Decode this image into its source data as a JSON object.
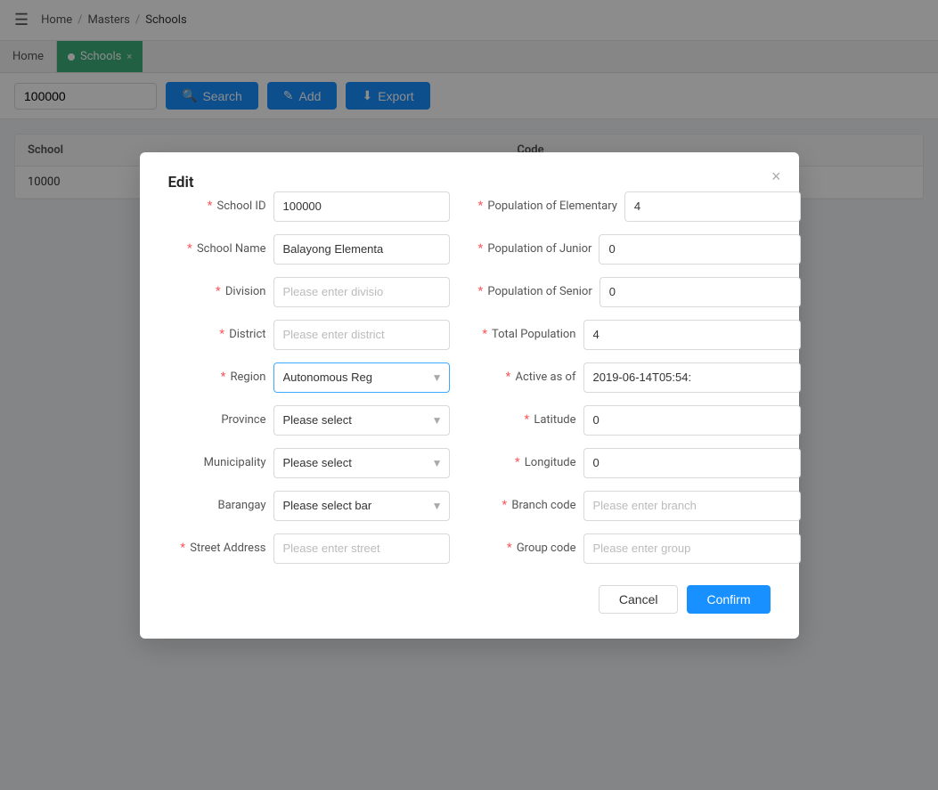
{
  "topbar": {
    "menu_icon": "☰",
    "breadcrumb": {
      "home": "Home",
      "sep1": "/",
      "masters": "Masters",
      "sep2": "/",
      "current": "Schools"
    }
  },
  "tabbar": {
    "home_label": "Home",
    "tab_label": "Schools",
    "tab_close": "×"
  },
  "toolbar": {
    "search_value": "100000",
    "search_btn": "Search",
    "add_btn": "Add",
    "export_btn": "Export"
  },
  "table": {
    "columns": [
      "School",
      "Code"
    ],
    "rows": [
      {
        "school": "10000",
        "code": ""
      }
    ]
  },
  "modal": {
    "title": "Edit",
    "close": "×",
    "fields": {
      "school_id_label": "School ID",
      "school_id_value": "100000",
      "pop_elem_label": "Population of Elementary",
      "pop_elem_value": "4",
      "school_name_label": "School Name",
      "school_name_value": "Balayong Elementa",
      "pop_junior_label": "Population of Junior",
      "pop_junior_value": "0",
      "division_label": "Division",
      "division_placeholder": "Please enter divisio",
      "pop_senior_label": "Population of Senior",
      "pop_senior_value": "0",
      "district_label": "District",
      "district_placeholder": "Please enter district",
      "total_pop_label": "Total Population",
      "total_pop_value": "4",
      "region_label": "Region",
      "region_value": "Autonomous Reg",
      "active_as_of_label": "Active as of",
      "active_as_of_value": "2019-06-14T05:54:",
      "province_label": "Province",
      "province_placeholder": "Please select",
      "latitude_label": "Latitude",
      "latitude_value": "0",
      "municipality_label": "Municipality",
      "municipality_placeholder": "Please select",
      "longitude_label": "Longitude",
      "longitude_value": "0",
      "barangay_label": "Barangay",
      "barangay_placeholder": "Please select bar",
      "branch_code_label": "Branch code",
      "branch_code_placeholder": "Please enter branch",
      "street_address_label": "Street Address",
      "street_placeholder": "Please enter street",
      "group_code_label": "Group code",
      "group_placeholder": "Please enter group"
    },
    "cancel_btn": "Cancel",
    "confirm_btn": "Confirm"
  }
}
